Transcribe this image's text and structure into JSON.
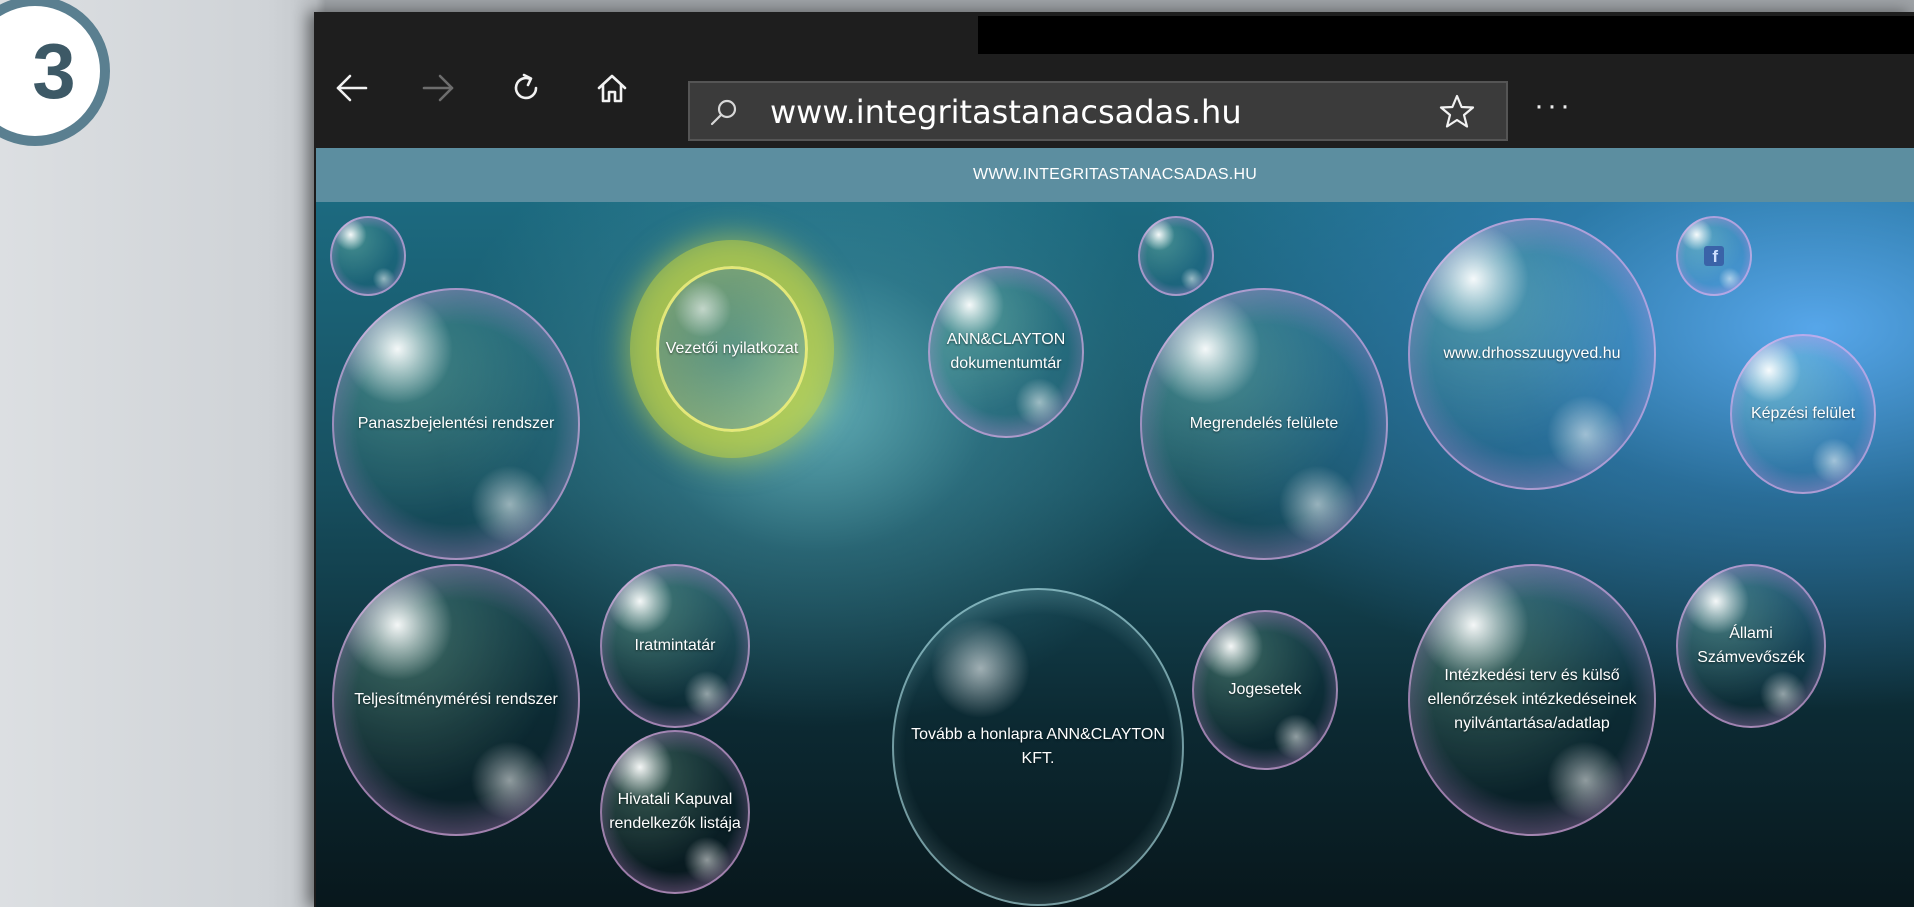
{
  "step_badge": {
    "number": "3"
  },
  "browser": {
    "nav": {
      "back_icon": "back-arrow-icon",
      "forward_icon": "forward-arrow-icon",
      "refresh_icon": "refresh-icon",
      "home_icon": "home-icon"
    },
    "address_bar": {
      "url": "www.integritastanacsadas.hu",
      "search_icon": "search-icon",
      "favorite_icon": "star-icon"
    },
    "more_menu": "···"
  },
  "page": {
    "header": "WWW.INTEGRITASTANACSADAS.HU",
    "bubbles": [
      {
        "id": "panasz",
        "label": "Panaszbejelentési rendszer"
      },
      {
        "id": "vezetoi",
        "label": "Vezetői nyilatkozat"
      },
      {
        "id": "annclayton-docs",
        "label": "ANN&CLAYTON dokumentumtár"
      },
      {
        "id": "megrendeles",
        "label": "Megrendelés felülete"
      },
      {
        "id": "drhossz",
        "label": "www.drhosszuugyved.hu"
      },
      {
        "id": "kepzesi",
        "label": "Képzési felület"
      },
      {
        "id": "teljesitmeny",
        "label": "Teljesítménymérési rendszer"
      },
      {
        "id": "iratminta",
        "label": "Iratmintatár"
      },
      {
        "id": "hivatali",
        "label": "Hivatali Kapuval rendelkezők listája"
      },
      {
        "id": "tovabb",
        "label": "Tovább a honlapra ANN&CLAYTON KFT."
      },
      {
        "id": "jogesetek",
        "label": "Jogesetek"
      },
      {
        "id": "intezkedesi",
        "label": "Intézkedési terv és külső ellenőrzések intézkedéseinek nyilvántartása/adatlap"
      },
      {
        "id": "allami",
        "label": "Állami Számvevőszék"
      }
    ],
    "facebook_icon": "facebook-icon",
    "facebook_glyph": "f"
  }
}
